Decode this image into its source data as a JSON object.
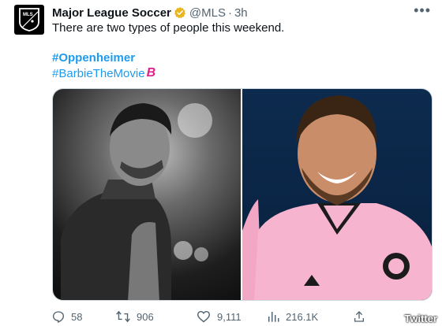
{
  "author": {
    "display_name": "Major League Soccer",
    "handle": "@MLS",
    "separator": "·",
    "time": "3h",
    "avatar_text": "MLS",
    "verified_color": "#e8b61e"
  },
  "tweet": {
    "text": "There are two types of people this weekend.",
    "hashtags": [
      "#Oppenheimer",
      "#BarbieTheMovie"
    ],
    "hashtag_color": "#1d9bf0",
    "barbie_emoji": "B",
    "barbie_color": "#e0218a"
  },
  "media": {
    "left_photo": "black-and-white-player-portrait",
    "right_photo": "smiling-player-pink-jersey"
  },
  "actions": {
    "replies": "58",
    "retweets": "906",
    "likes": "9,111",
    "views": "216.1K"
  },
  "more_label": "•••",
  "watermark": "Twitter"
}
